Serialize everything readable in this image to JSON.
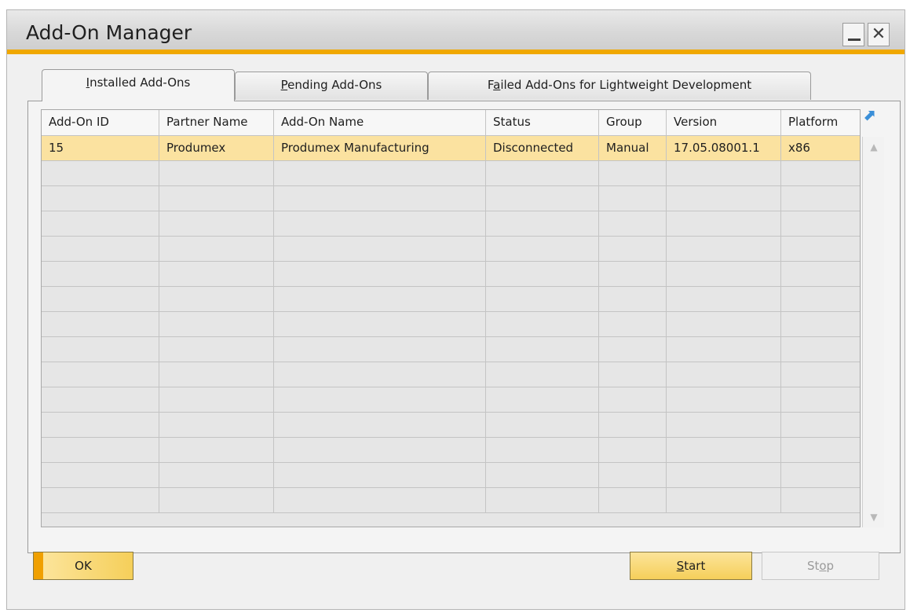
{
  "window": {
    "title": "Add-On Manager"
  },
  "tabs": [
    {
      "label_u": "I",
      "label_rest": "nstalled Add-Ons"
    },
    {
      "label_u": "P",
      "label_rest": "ending Add-Ons"
    },
    {
      "label_pre": "F",
      "label_u": "a",
      "label_rest": "iled Add-Ons for Lightweight Development"
    }
  ],
  "grid": {
    "columns": [
      "Add-On ID",
      "Partner Name",
      "Add-On Name",
      "Status",
      "Group",
      "Version",
      "Platform"
    ],
    "rows": [
      [
        "15",
        "Produmex",
        "Produmex Manufacturing",
        "Disconnected",
        "Manual",
        "17.05.08001.1",
        "x86"
      ]
    ]
  },
  "buttons": {
    "ok": "OK",
    "start_u": "S",
    "start_rest": "tart",
    "stop_pre": "St",
    "stop_u": "o",
    "stop_rest": "p"
  }
}
